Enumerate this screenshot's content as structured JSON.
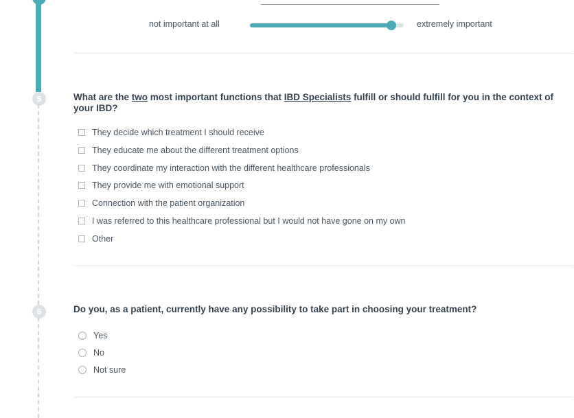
{
  "timeline": {
    "steps": [
      {
        "number": "5"
      },
      {
        "number": "6"
      }
    ]
  },
  "slider": {
    "min_label": "not important at all",
    "max_label": "extremely important",
    "value_fraction": 0.92
  },
  "question5": {
    "title_prefix": "What are the ",
    "title_emph1": "two",
    "title_mid": " most important functions that ",
    "title_emph2": "IBD Specialists",
    "title_suffix": " fulfill or should fulfill for you in the context of your IBD?",
    "options": [
      "They decide which treatment I should receive",
      "They educate me about the different treatment options",
      "They coordinate my interaction with the different healthcare professionals",
      "They provide me with emotional support",
      "Connection with the patient organization",
      "I was referred to this healthcare professional but I would not have gone on my own",
      "Other"
    ]
  },
  "question6": {
    "title": "Do you, as a patient, currently have any possibility to take part in choosing your treatment?",
    "options": [
      "Yes",
      "No",
      "Not sure"
    ]
  },
  "colors": {
    "accent": "#4aaab6",
    "badge": "#dfe3e6",
    "text": "#4a5560",
    "heading": "#34424f"
  }
}
